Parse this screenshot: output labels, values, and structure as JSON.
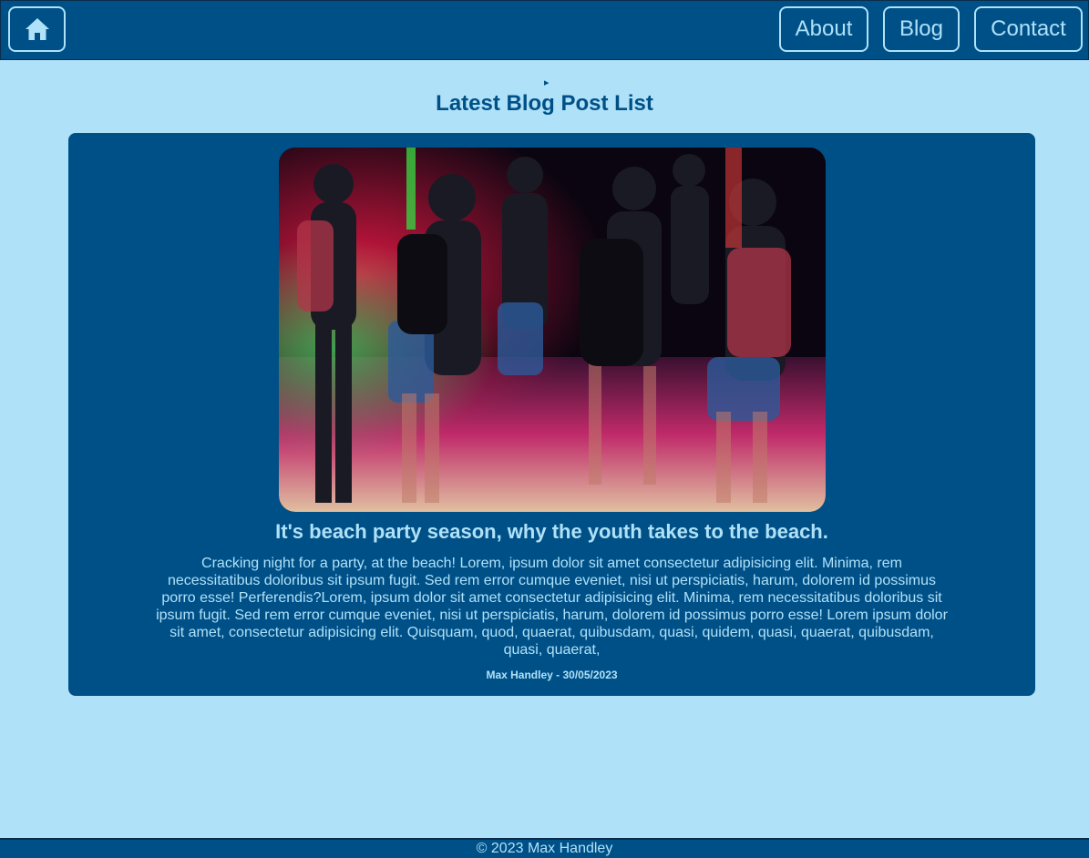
{
  "nav": {
    "home_icon": "home-icon",
    "links": [
      "About",
      "Blog",
      "Contact"
    ]
  },
  "main": {
    "toggle_glyph": "▸",
    "heading": "Latest Blog Post List"
  },
  "post": {
    "image_subject": "night beach party crowd dancing under coloured lights",
    "title": "It's beach party season, why the youth takes to the beach.",
    "body": "Cracking night for a party, at the beach! Lorem, ipsum dolor sit amet consectetur adipisicing elit. Minima, rem necessitatibus doloribus sit ipsum fugit. Sed rem error cumque eveniet, nisi ut perspiciatis, harum, dolorem id possimus porro esse! Perferendis?Lorem, ipsum dolor sit amet consectetur adipisicing elit. Minima, rem necessitatibus doloribus sit ipsum fugit. Sed rem error cumque eveniet, nisi ut perspiciatis, harum, dolorem id possimus porro esse! Lorem ipsum dolor sit amet, consectetur adipisicing elit. Quisquam, quod, quaerat, quibusdam, quasi, quidem, quasi, quaerat, quibusdam, quasi, quaerat,",
    "meta": "Max Handley - 30/05/2023"
  },
  "footer": {
    "text": "© 2023 Max Handley"
  },
  "colors": {
    "background": "#afe1f8",
    "primary": "#005088",
    "text_light": "#afe1f8"
  }
}
